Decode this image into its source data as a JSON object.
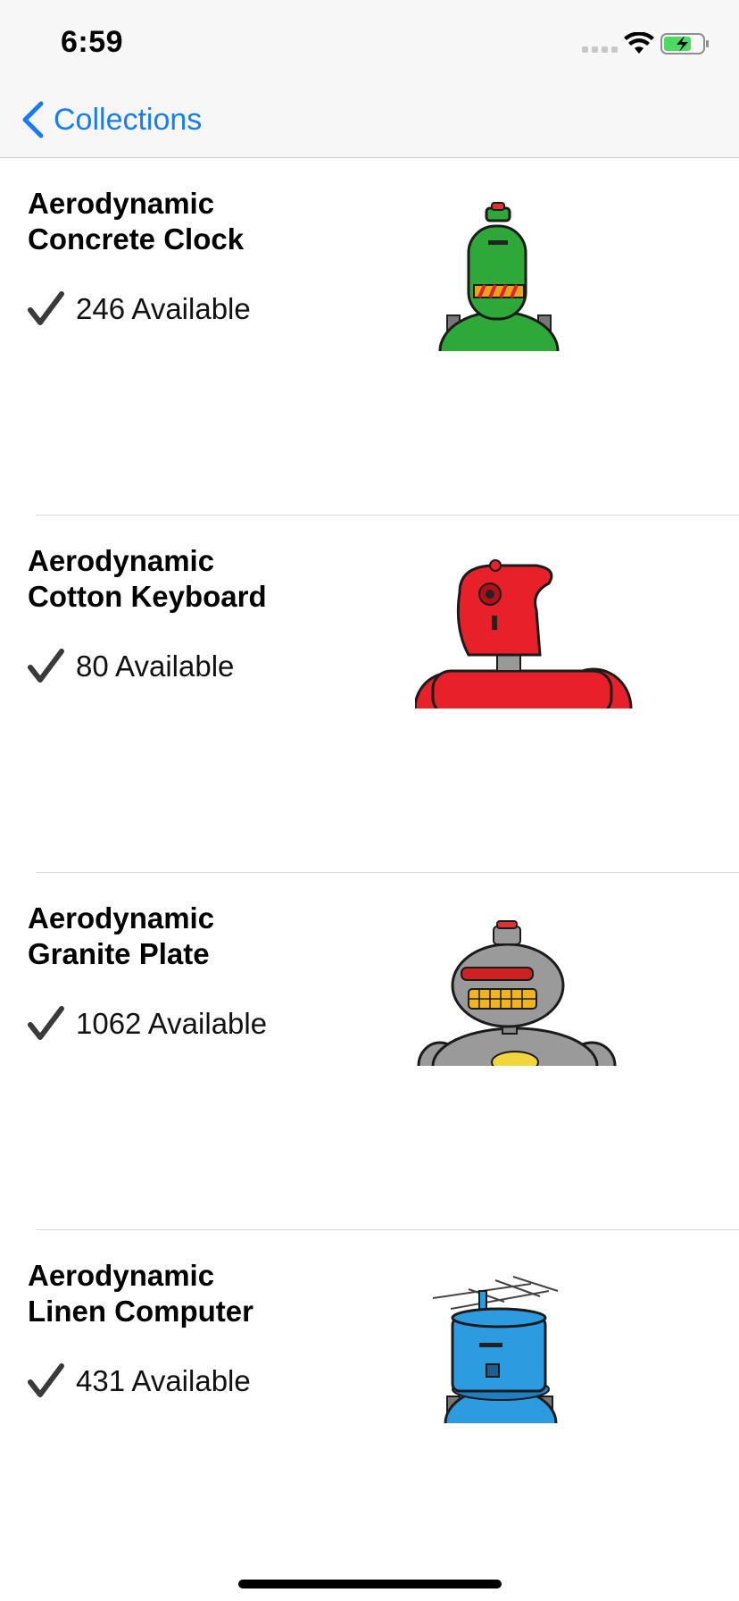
{
  "status_bar": {
    "time": "6:59"
  },
  "nav": {
    "back_label": "Collections"
  },
  "items": [
    {
      "title_line1": "Aerodynamic",
      "title_line2": "Concrete Clock",
      "available": "246 Available",
      "robot_color": "#2fa83a",
      "robot": "green-robot"
    },
    {
      "title_line1": "Aerodynamic",
      "title_line2": "Cotton Keyboard",
      "available": "80 Available",
      "robot_color": "#e8202a",
      "robot": "red-robot"
    },
    {
      "title_line1": "Aerodynamic",
      "title_line2": "Granite Plate",
      "available": "1062 Available",
      "robot_color": "#9a9a9a",
      "robot": "gray-robot"
    },
    {
      "title_line1": "Aerodynamic",
      "title_line2": "Linen Computer",
      "available": "431 Available",
      "robot_color": "#2d9be0",
      "robot": "blue-robot"
    }
  ],
  "colors": {
    "accent": "#1a7cf5",
    "checkmark": "#3a3a3c"
  }
}
